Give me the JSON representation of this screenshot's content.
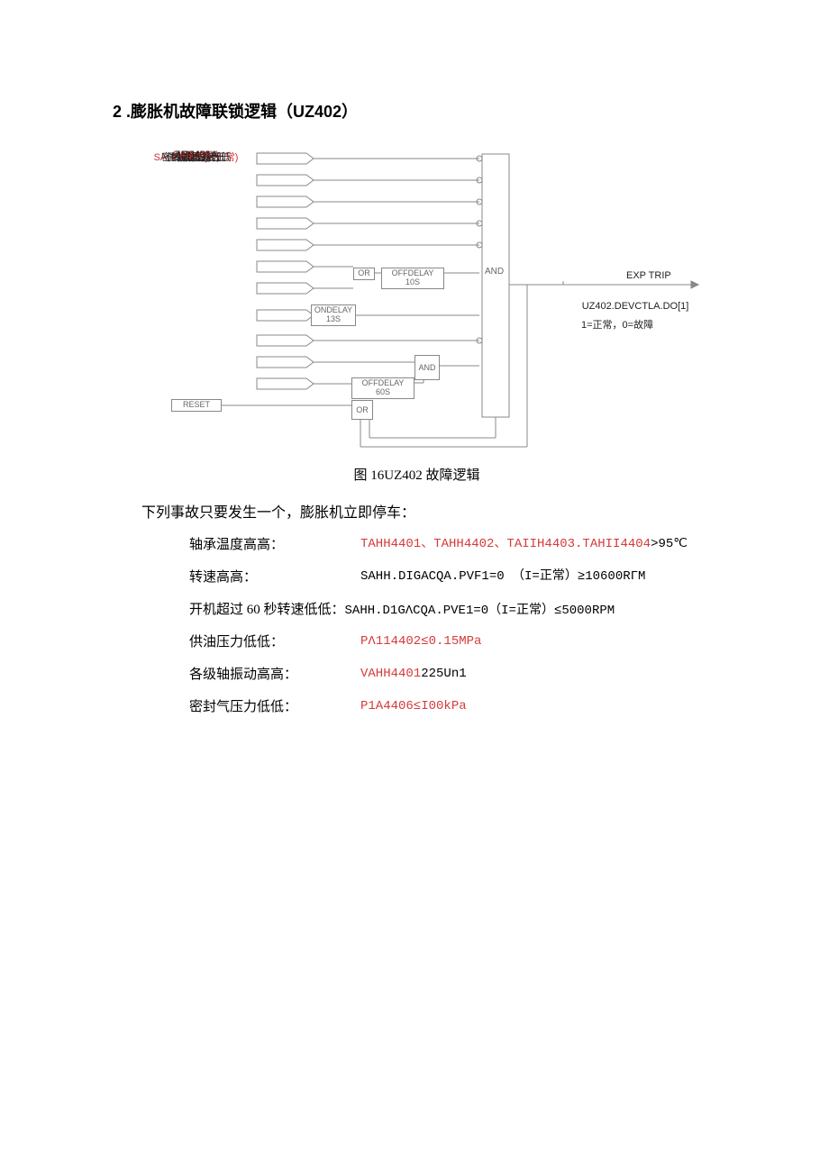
{
  "title": "2 .膨胀机故障联锁逻辑（UZ402）",
  "diagram": {
    "inputs": [
      {
        "label": "轴承温度",
        "cls": "black"
      },
      {
        "label": "SAHH4401(I=正常)",
        "cls": "red"
      },
      {
        "label": "供油压力低低",
        "cls": "black"
      },
      {
        "label": "轴振动",
        "cls": "black"
      },
      {
        "label": "密封气压力低低",
        "cls": "black"
      },
      {
        "label": "P4402",
        "cls": "red"
      },
      {
        "label": "P4403",
        "cls": "red"
      },
      {
        "label": "膨胀机运行",
        "cls": "black"
      },
      {
        "label": "HS401",
        "cls": "black"
      },
      {
        "label": "SALL4401",
        "cls": "red"
      },
      {
        "label": "ZSH401A",
        "cls": "black"
      }
    ],
    "reset": "RESET",
    "or1": "OR",
    "offdelay10": "OFFDELAY 10S",
    "ondelay13": "ONDELAY\n13S",
    "and2": "AND",
    "offdelay60": "OFFDELAY 60S",
    "or2": "OR",
    "and_main": "AND",
    "output_top": "EXP TRIP",
    "output_line1": "UZ402.DEVCTLA.DO[1]",
    "output_line2": "1=正常，0=故障"
  },
  "caption": "图 16UZ402 故障逻辑",
  "intro": "下列事故只要发生一个，膨胀机立即停车：",
  "conditions": [
    {
      "label": "轴承温度高高：",
      "val_red": "TAHH4401、TAHH4402、TAIIH4403.TAHII4404",
      "val_black": ">95℃"
    },
    {
      "label": "转速高高：",
      "val_red": "",
      "val_black": "SAHH.DIGACQA.PVF1=0  （I=正常）≥10600RΓM"
    },
    {
      "label": "开机超过 60 秒转速低低：",
      "val_red": "",
      "val_black": "SAHH.D1GΛCQA.PVE1=0（I=正常）≤5000RPM",
      "single_line": true
    },
    {
      "label": "供油压力低低：",
      "val_red": "PΛ114402≤0.15MPa",
      "val_black": ""
    },
    {
      "label": "各级轴振动高高：",
      "val_red": "VAHH4401",
      "val_black": "225Un1"
    },
    {
      "label": "密封气压力低低：",
      "val_red": "P1A4406≤I00kPa",
      "val_black": ""
    }
  ]
}
